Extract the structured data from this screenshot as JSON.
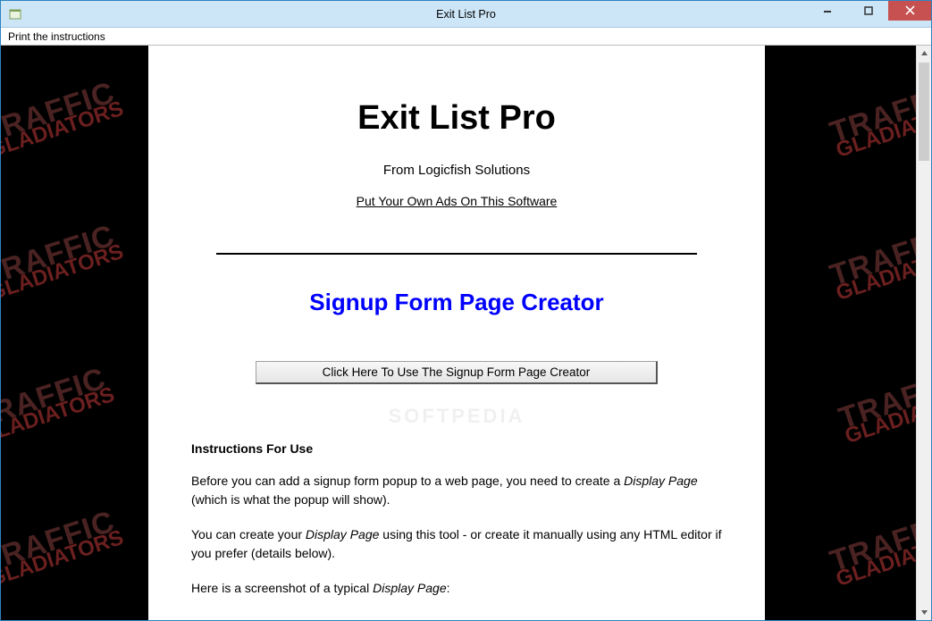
{
  "window": {
    "title": "Exit List Pro"
  },
  "menubar": {
    "print_instructions": "Print the instructions"
  },
  "watermark": {
    "line1": "TRAFFIC",
    "line2": "GLADIATORS"
  },
  "content": {
    "title": "Exit List Pro",
    "from_line": "From Logicfish Solutions",
    "ads_link": "Put Your Own Ads On This Software",
    "section_title": "Signup Form Page Creator",
    "creator_button_label": "Click Here To Use The Signup Form Page Creator",
    "instructions_heading": "Instructions For Use",
    "para1_a": "Before you can add a signup form popup to a web page, you need to create a ",
    "para1_ital": "Display Page",
    "para1_b": " (which is what the popup will show).",
    "para2_a": "You can create your ",
    "para2_ital": "Display Page",
    "para2_b": " using this tool - or create it manually using any HTML editor if you prefer (details below).",
    "para3_a": "Here is a screenshot of a typical ",
    "para3_ital": "Display Page",
    "para3_b": ":"
  },
  "softpedia": "SOFTPEDIA"
}
